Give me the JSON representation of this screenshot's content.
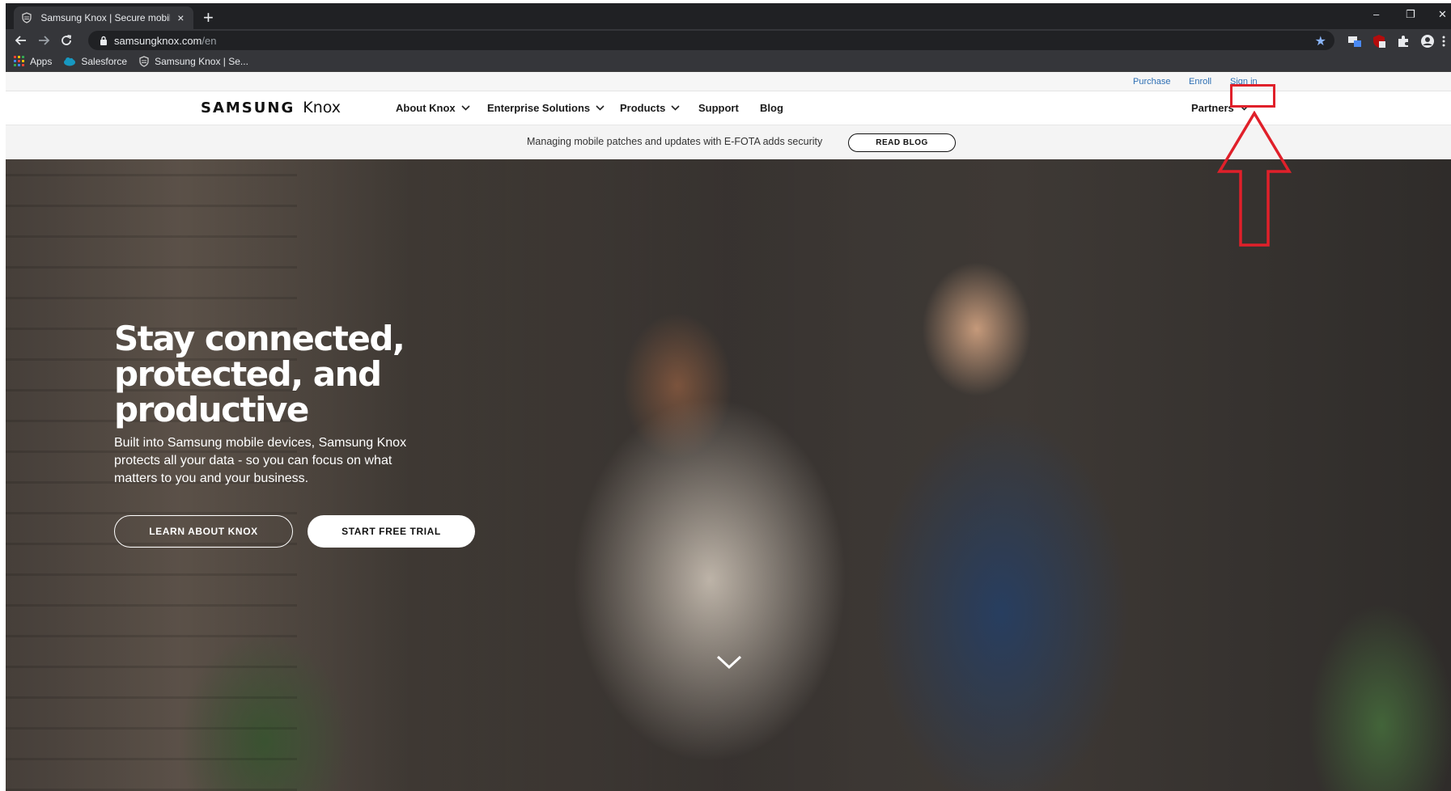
{
  "browser": {
    "tab_title": "Samsung Knox | Secure mobile p",
    "new_tab_symbol": "+",
    "close_symbol": "×",
    "url_host": "samsungknox.com",
    "url_path": "/en",
    "window_controls": {
      "minimize": "–",
      "restore": "❐",
      "close": "✕"
    }
  },
  "bookmarks": [
    {
      "label": "Apps",
      "icon": "apps-grid-icon"
    },
    {
      "label": "Salesforce",
      "icon": "salesforce-cloud-icon"
    },
    {
      "label": "Samsung Knox | Se...",
      "icon": "knox-shield-icon"
    }
  ],
  "utility_nav": {
    "purchase": "Purchase",
    "enroll": "Enroll",
    "sign_in": "Sign in"
  },
  "logo": {
    "brand": "SAMSUNG",
    "product": "Knox"
  },
  "main_nav": {
    "about_knox": "About Knox",
    "enterprise_solutions": "Enterprise Solutions",
    "products": "Products",
    "support": "Support",
    "blog": "Blog",
    "partners": "Partners"
  },
  "promo": {
    "text": "Managing mobile patches and updates with E-FOTA adds security",
    "button": "READ BLOG"
  },
  "hero": {
    "title_line1": "Stay connected,",
    "title_line2": "protected, and",
    "title_line3": "productive",
    "subtitle": "Built into Samsung mobile devices, Samsung Knox protects all your data - so you can focus on what matters to you and your business.",
    "learn_button": "LEARN ABOUT KNOX",
    "trial_button": "START FREE TRIAL"
  },
  "colors": {
    "link_blue": "#2d6fb4",
    "annotation_red": "#e0202a",
    "browser_dark": "#202124",
    "browser_toolbar": "#35363a"
  }
}
